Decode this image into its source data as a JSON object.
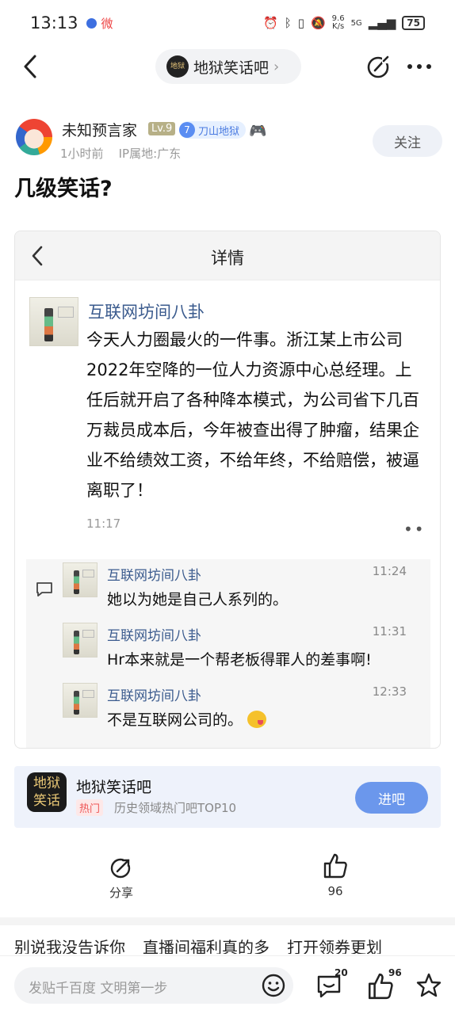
{
  "status_bar": {
    "time": "13:13",
    "weibo_label": "微",
    "net_speed_top": "9.6",
    "net_speed_bottom": "K/s",
    "signal": "5G",
    "battery": "75"
  },
  "nav": {
    "forum_logo_text": "地狱",
    "forum_name": "地狱笑话吧",
    "chevron": "›"
  },
  "post": {
    "username": "未知预言家",
    "level": "Lv.9",
    "badge_number": "7",
    "badge_title": "刀山地狱",
    "meta": "1小时前    IP属地:广东",
    "follow_label": "关注",
    "title": "几级笑话?"
  },
  "screenshot": {
    "header_title": "详情",
    "original": {
      "name": "互联网坊间八卦",
      "text": "今天人力圈最火的一件事。浙江某上市公司2022年空降的一位人力资源中心总经理。上任后就开启了各种降本模式，为公司省下几百万裁员成本后，今年被查出得了肿瘤，结果企业不给绩效工资，不给年终，不给赔偿，被逼离职了！",
      "time": "11:17",
      "more": "••"
    },
    "comments": [
      {
        "name": "互联网坊间八卦",
        "time": "11:24",
        "text": "她以为她是自己人系列的。"
      },
      {
        "name": "互联网坊间八卦",
        "time": "11:31",
        "text": "Hr本来就是一个帮老板得罪人的差事啊!"
      },
      {
        "name": "互联网坊间八卦",
        "time": "12:33",
        "text": "不是互联网公司的。"
      }
    ]
  },
  "forum_card": {
    "logo_text": "地狱笑话",
    "name": "地狱笑话吧",
    "hot_tag": "热门",
    "desc": "历史领域热门吧TOP10",
    "enter_label": "进吧"
  },
  "actions": {
    "share_label": "分享",
    "like_count": "96"
  },
  "recommend": [
    "别说我没告诉你",
    "直播间福利真的多",
    "打开领券更划"
  ],
  "bottom_bar": {
    "placeholder": "发贴千百度 文明第一步",
    "comment_count": "20",
    "like_count": "96"
  }
}
